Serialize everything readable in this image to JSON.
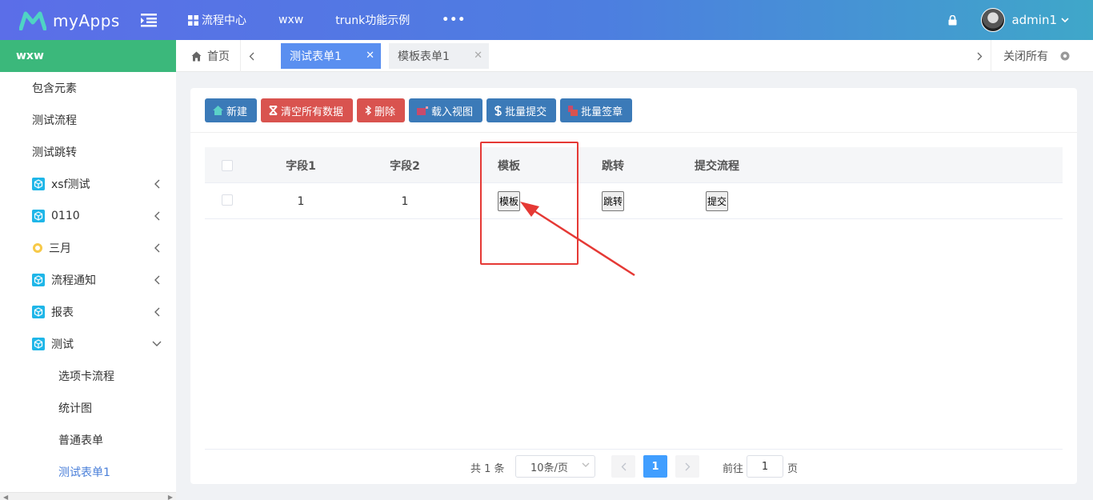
{
  "app": {
    "name": "myApps"
  },
  "topnav": {
    "items": [
      {
        "label": "流程中心"
      },
      {
        "label": "wxw"
      },
      {
        "label": "trunk功能示例"
      },
      {
        "label": "•••"
      }
    ]
  },
  "user": {
    "name": "admin1"
  },
  "sidebar": {
    "header": "wxw",
    "items": [
      {
        "label": "包含元素"
      },
      {
        "label": "测试流程"
      },
      {
        "label": "测试跳转"
      },
      {
        "label": "xsf测试"
      },
      {
        "label": "0110"
      },
      {
        "label": "三月"
      },
      {
        "label": "流程通知"
      },
      {
        "label": "报表"
      },
      {
        "label": "测试"
      }
    ],
    "subitems": [
      {
        "label": "选项卡流程"
      },
      {
        "label": "统计图"
      },
      {
        "label": "普通表单"
      },
      {
        "label": "测试表单1"
      }
    ]
  },
  "tabs": {
    "home": "首页",
    "items": [
      {
        "label": "测试表单1"
      },
      {
        "label": "模板表单1"
      }
    ],
    "close_all": "关闭所有"
  },
  "toolbar": {
    "new": "新建",
    "clear": "清空所有数据",
    "delete": "删除",
    "load_view": "载入视图",
    "batch_submit": "批量提交",
    "batch_sign": "批量签章"
  },
  "table": {
    "headers": [
      "字段1",
      "字段2",
      "模板",
      "跳转",
      "提交流程"
    ],
    "rows": [
      {
        "field1": "1",
        "field2": "1",
        "template_btn": "模板",
        "jump_btn": "跳转",
        "submit_btn": "提交"
      }
    ]
  },
  "pagination": {
    "total": "共 1 条",
    "page_size": "10条/页",
    "current_page": "1",
    "goto_label": "前往",
    "goto_value": "1",
    "page_unit": "页"
  },
  "colors": {
    "topbar_start": "#5b6ee8",
    "topbar_end": "#3fa7c9",
    "sidebar_header": "#3bb87b",
    "active_tab": "#5a8ff0",
    "btn_blue": "#3b7ab8",
    "btn_red": "#d9534f",
    "highlight": "#e53935"
  }
}
